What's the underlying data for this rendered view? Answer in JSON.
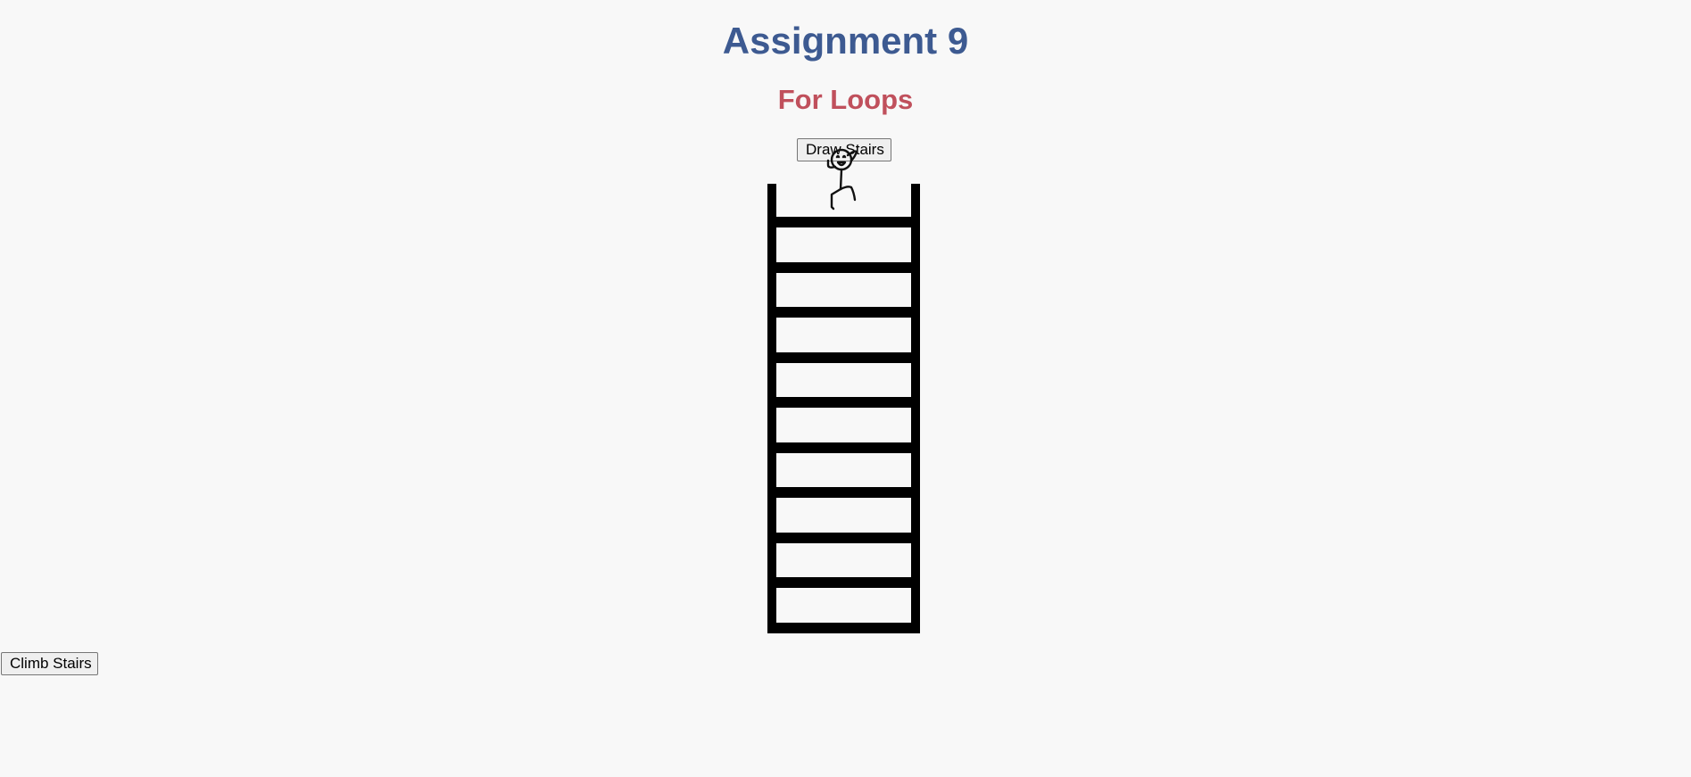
{
  "header": {
    "title": "Assignment 9",
    "subtitle": "For Loops",
    "title_color": "#3d5a91",
    "subtitle_color": "#c0505c"
  },
  "controls": {
    "draw_label": "Draw Stairs",
    "climb_label": "Climb Stairs"
  },
  "ladder": {
    "rung_count": 10,
    "color": "#000000"
  },
  "figure": {
    "icon": "stick-figure-icon"
  }
}
